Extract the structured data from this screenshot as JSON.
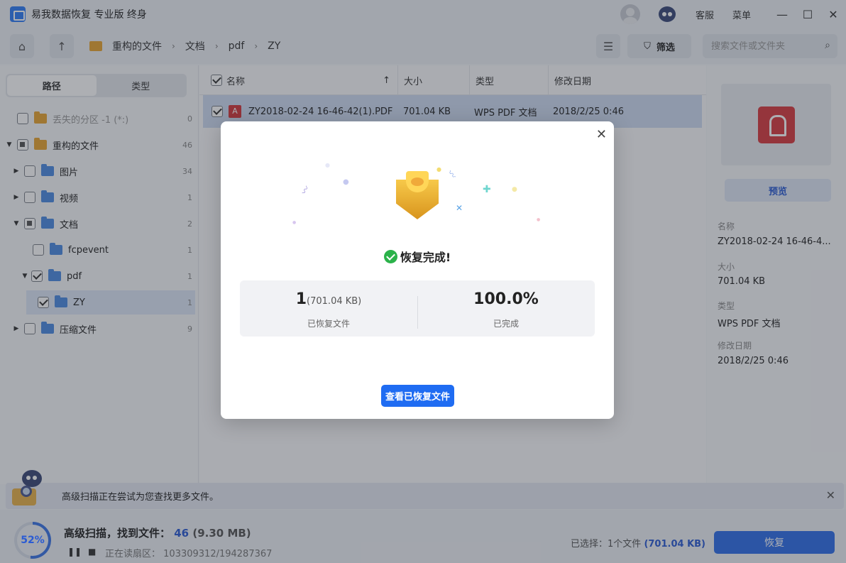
{
  "app": {
    "title": "易我数据恢复 专业版 终身"
  },
  "titlebar": {
    "support": "客服",
    "menu": "菜单",
    "minimize": "—",
    "maximize": "☐",
    "close": "✕"
  },
  "toolbar": {
    "breadcrumb": [
      "重构的文件",
      "文档",
      "pdf",
      "ZY"
    ],
    "filter_label": "筛选",
    "search_placeholder": "搜索文件或文件夹"
  },
  "left": {
    "tabs": [
      "路径",
      "类型"
    ],
    "tree": [
      {
        "label": "丢失的分区 -1 (*:)",
        "count": "0"
      },
      {
        "label": "重构的文件",
        "count": "46"
      },
      {
        "label": "图片",
        "count": "34"
      },
      {
        "label": "视频",
        "count": "1"
      },
      {
        "label": "文档",
        "count": "2"
      },
      {
        "label": "fcpevent",
        "count": "1"
      },
      {
        "label": "pdf",
        "count": "1"
      },
      {
        "label": "ZY",
        "count": "1"
      },
      {
        "label": "压缩文件",
        "count": "9"
      }
    ]
  },
  "table": {
    "headers": [
      "名称",
      "大小",
      "类型",
      "修改日期"
    ],
    "rows": [
      {
        "name": "ZY2018-02-24 16-46-42(1).PDF",
        "size": "701.04 KB",
        "type": "WPS PDF 文档",
        "date": "2018/2/25 0:46"
      }
    ]
  },
  "details": {
    "preview_label": "预览",
    "name_label": "名称",
    "name_value": "ZY2018-02-24 16-46-4...",
    "size_label": "大小",
    "size_value": "701.04 KB",
    "type_label": "类型",
    "type_value": "WPS PDF 文档",
    "date_label": "修改日期",
    "date_value": "2018/2/25 0:46"
  },
  "notice": {
    "text": "高级扫描正在尝试为您查找更多文件。"
  },
  "status": {
    "progress_percent": 52,
    "progress_label": "52%",
    "scan_title": "高级扫描，找到文件：",
    "scan_count": "46",
    "scan_size": "(9.30 MB)",
    "pause": "❚❚",
    "stop": "■",
    "reading_label": "正在读扇区：",
    "reading_value": "103309312/194287367",
    "selected_prefix": "已选择：",
    "selected_count": "1个文件",
    "selected_size": "(701.04 KB)",
    "recover_button": "恢复"
  },
  "modal": {
    "done_text": "恢复完成!",
    "recovered_count": "1",
    "recovered_size": "(701.04 KB)",
    "recovered_label": "已恢复文件",
    "percent_value": "100.0%",
    "percent_label": "已完成",
    "view_button": "查看已恢复文件",
    "close": "✕"
  },
  "colors": {
    "accent": "#1f6cf2",
    "success": "#2bb24a",
    "pdf": "#d6373d"
  }
}
